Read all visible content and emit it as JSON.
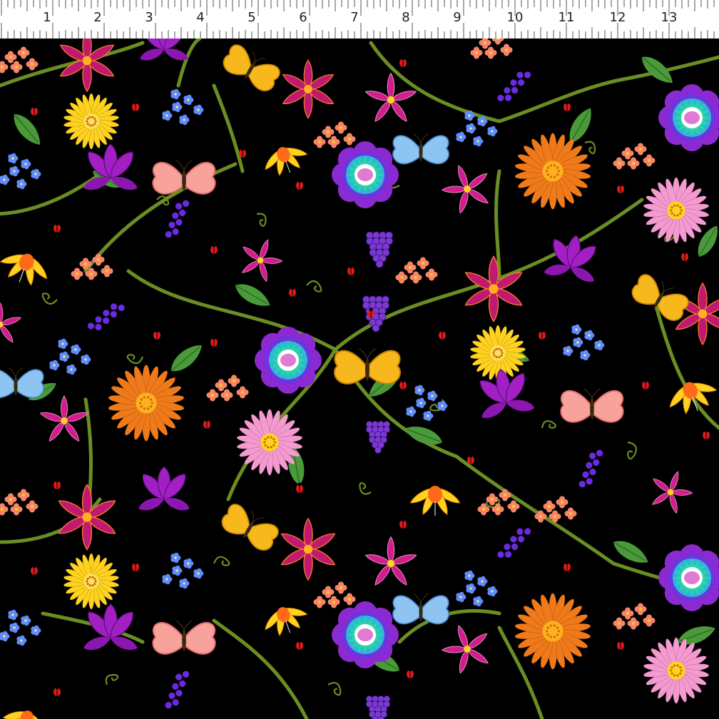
{
  "ruler": {
    "numbers": [
      "1",
      "2",
      "3",
      "4",
      "5",
      "6",
      "7",
      "8",
      "9",
      "10",
      "11",
      "12",
      "13"
    ]
  },
  "colors": {
    "background": "#000000",
    "vine": "#6b8e23",
    "leaf": "#4a9a3a",
    "orange_daisy": "#f07a1a",
    "yellow_daisy": "#ffd21f",
    "pink_daisy": "#f59ad0",
    "blue_flower": "#2fb5d8",
    "purple_petal": "#8a2ad0",
    "magenta": "#d21e8c",
    "butterfly_yellow": "#f7b81d",
    "butterfly_pink": "#f7a29a",
    "butterfly_blue": "#8ec4f2",
    "ladybug": "#e01a1a"
  },
  "motifs": [
    "orange-daisy",
    "yellow-daisy",
    "pink-daisy",
    "blue-mandala-flower",
    "purple-tulip",
    "magenta-lily",
    "yellow-butterfly",
    "pink-butterfly",
    "blue-butterfly",
    "lavender-sprig",
    "forget-me-not",
    "ladybug"
  ]
}
